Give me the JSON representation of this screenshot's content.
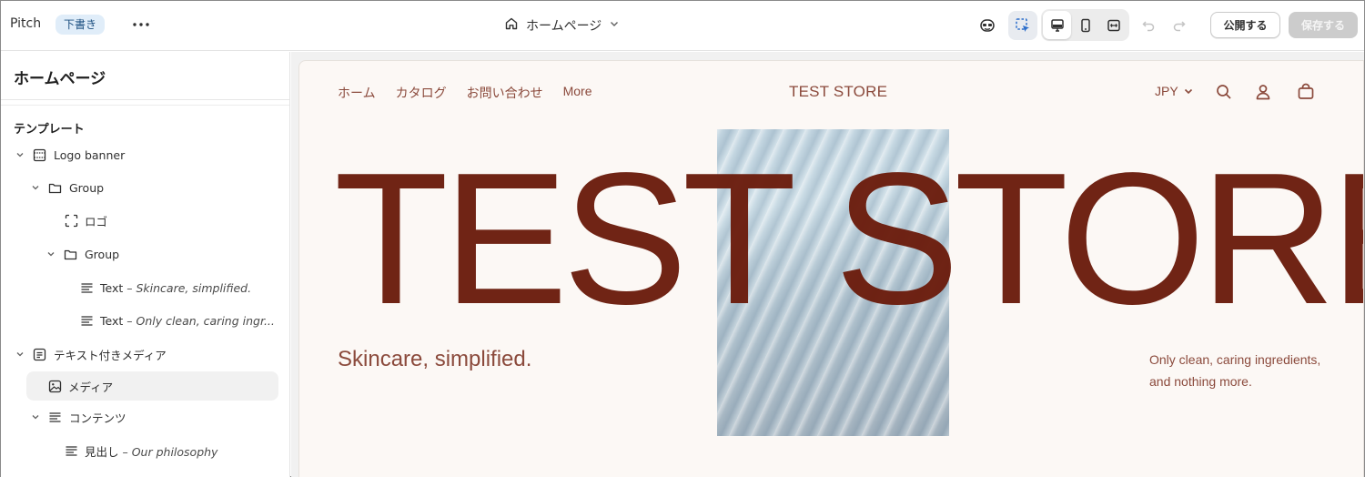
{
  "topbar": {
    "app_name": "Pitch",
    "status_badge": "下書き",
    "page_selector": "ホームページ",
    "publish_label": "公開する",
    "save_label": "保存する"
  },
  "sidebar": {
    "title": "ホームページ",
    "section_label": "テンプレート",
    "items": [
      {
        "label": "Logo banner",
        "detail": "",
        "icon": "layout-section-icon"
      },
      {
        "label": "Group",
        "detail": "",
        "icon": "folder-icon"
      },
      {
        "label": "ロゴ",
        "detail": "",
        "icon": "dashed-square-icon"
      },
      {
        "label": "Group",
        "detail": "",
        "icon": "folder-icon"
      },
      {
        "label": "Text",
        "detail": " – Skincare, simplified.",
        "icon": "text-lines-icon"
      },
      {
        "label": "Text",
        "detail": " – Only clean, caring ingr...",
        "icon": "text-lines-icon"
      },
      {
        "label": "テキスト付きメディア",
        "detail": "",
        "icon": "section-icon"
      },
      {
        "label": "メディア",
        "detail": "",
        "icon": "image-icon"
      },
      {
        "label": "コンテンツ",
        "detail": "",
        "icon": "text-lines-icon"
      },
      {
        "label": "見出し",
        "detail": " – Our philosophy",
        "icon": "text-lines-icon"
      }
    ]
  },
  "preview": {
    "nav_links": [
      "ホーム",
      "カタログ",
      "お問い合わせ",
      "More"
    ],
    "store_title": "TEST STORE",
    "currency": "JPY",
    "hero_heading": "TEST STORE",
    "tagline": "Skincare, simplified.",
    "description_lines": [
      "Only clean, caring ingredients,",
      "and nothing more."
    ]
  },
  "colors": {
    "brand_text": "#8b4a3c",
    "hero_text": "#6b1d0d",
    "preview_bg": "#fcf8f5",
    "badge_bg": "#e0edf9",
    "inspector_active": "#2c6ecb"
  }
}
